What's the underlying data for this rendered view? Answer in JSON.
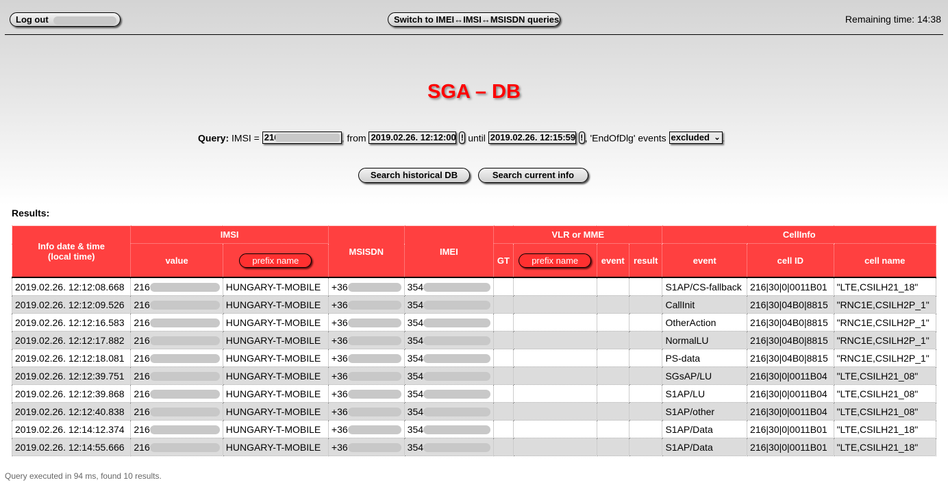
{
  "top": {
    "logout_label": "Log out",
    "switch_label": "Switch to IMEI↔IMSI↔MSISDN queries",
    "remaining_time": "Remaining time: 14:38"
  },
  "title": "SGA – DB",
  "query": {
    "label": "Query:",
    "imsi_prefix": "IMSI =",
    "imsi_value": "216",
    "from_label": ", from",
    "from_value": "2019.02.26. 12:12:00",
    "until_label": "until",
    "until_value": "2019.02.26. 12:15:59",
    "events_label": ", 'EndOfDlg' events",
    "events_selected": "excluded",
    "bang": "!"
  },
  "buttons": {
    "historical": "Search historical DB",
    "current": "Search current info"
  },
  "results_label": "Results:",
  "table": {
    "group_headers": {
      "info": "Info date & time (local time)",
      "imsi": "IMSI",
      "msisdn": "MSISDN",
      "imei": "IMEI",
      "vlr": "VLR or MME",
      "cellinfo": "CellInfo"
    },
    "sub_headers": {
      "imsi_value": "value",
      "imsi_prefix": "prefix name",
      "vlr_gt": "GT",
      "vlr_prefix": "prefix name",
      "vlr_event": "event",
      "vlr_result": "result",
      "cell_event": "event",
      "cell_id": "cell ID",
      "cell_name": "cell name"
    },
    "rows": [
      {
        "time": "2019.02.26. 12:12:08.668",
        "imsi": "216",
        "prefix": "HUNGARY-T-MOBILE",
        "msisdn": "+36",
        "imei": "354",
        "gt": "",
        "vprefix": "",
        "vevent": "",
        "vresult": "",
        "event": "S1AP/CS-fallback",
        "cellid": "216|30|0|0011B01",
        "cellname": "\"LTE,CSILH21_18\""
      },
      {
        "time": "2019.02.26. 12:12:09.526",
        "imsi": "216",
        "prefix": "HUNGARY-T-MOBILE",
        "msisdn": "+36",
        "imei": "354",
        "gt": "",
        "vprefix": "",
        "vevent": "",
        "vresult": "",
        "event": "CallInit",
        "cellid": "216|30|04B0|8815",
        "cellname": "\"RNC1E,CSILH2P_1\""
      },
      {
        "time": "2019.02.26. 12:12:16.583",
        "imsi": "216",
        "prefix": "HUNGARY-T-MOBILE",
        "msisdn": "+36",
        "imei": "354",
        "gt": "",
        "vprefix": "",
        "vevent": "",
        "vresult": "",
        "event": "OtherAction",
        "cellid": "216|30|04B0|8815",
        "cellname": "\"RNC1E,CSILH2P_1\""
      },
      {
        "time": "2019.02.26. 12:12:17.882",
        "imsi": "216",
        "prefix": "HUNGARY-T-MOBILE",
        "msisdn": "+36",
        "imei": "354",
        "gt": "",
        "vprefix": "",
        "vevent": "",
        "vresult": "",
        "event": "NormalLU",
        "cellid": "216|30|04B0|8815",
        "cellname": "\"RNC1E,CSILH2P_1\""
      },
      {
        "time": "2019.02.26. 12:12:18.081",
        "imsi": "216",
        "prefix": "HUNGARY-T-MOBILE",
        "msisdn": "+36",
        "imei": "354",
        "gt": "",
        "vprefix": "",
        "vevent": "",
        "vresult": "",
        "event": "PS-data",
        "cellid": "216|30|04B0|8815",
        "cellname": "\"RNC1E,CSILH2P_1\""
      },
      {
        "time": "2019.02.26. 12:12:39.751",
        "imsi": "216",
        "prefix": "HUNGARY-T-MOBILE",
        "msisdn": "+36",
        "imei": "354",
        "gt": "",
        "vprefix": "",
        "vevent": "",
        "vresult": "",
        "event": "SGsAP/LU",
        "cellid": "216|30|0|0011B04",
        "cellname": "\"LTE,CSILH21_08\""
      },
      {
        "time": "2019.02.26. 12:12:39.868",
        "imsi": "216",
        "prefix": "HUNGARY-T-MOBILE",
        "msisdn": "+36",
        "imei": "354",
        "gt": "",
        "vprefix": "",
        "vevent": "",
        "vresult": "",
        "event": "S1AP/LU",
        "cellid": "216|30|0|0011B04",
        "cellname": "\"LTE,CSILH21_08\""
      },
      {
        "time": "2019.02.26. 12:12:40.838",
        "imsi": "216",
        "prefix": "HUNGARY-T-MOBILE",
        "msisdn": "+36",
        "imei": "354",
        "gt": "",
        "vprefix": "",
        "vevent": "",
        "vresult": "",
        "event": "S1AP/other",
        "cellid": "216|30|0|0011B04",
        "cellname": "\"LTE,CSILH21_08\""
      },
      {
        "time": "2019.02.26. 12:14:12.374",
        "imsi": "216",
        "prefix": "HUNGARY-T-MOBILE",
        "msisdn": "+36",
        "imei": "354",
        "gt": "",
        "vprefix": "",
        "vevent": "",
        "vresult": "",
        "event": "S1AP/Data",
        "cellid": "216|30|0|0011B01",
        "cellname": "\"LTE,CSILH21_18\""
      },
      {
        "time": "2019.02.26. 12:14:55.666",
        "imsi": "216",
        "prefix": "HUNGARY-T-MOBILE",
        "msisdn": "+36",
        "imei": "354",
        "gt": "",
        "vprefix": "",
        "vevent": "",
        "vresult": "",
        "event": "S1AP/Data",
        "cellid": "216|30|0|0011B01",
        "cellname": "\"LTE,CSILH21_18\""
      }
    ]
  },
  "footer": "Query executed in 94 ms, found 10 results.",
  "colors": {
    "accent_red": "#ff4040",
    "title_red": "#ff0000"
  }
}
